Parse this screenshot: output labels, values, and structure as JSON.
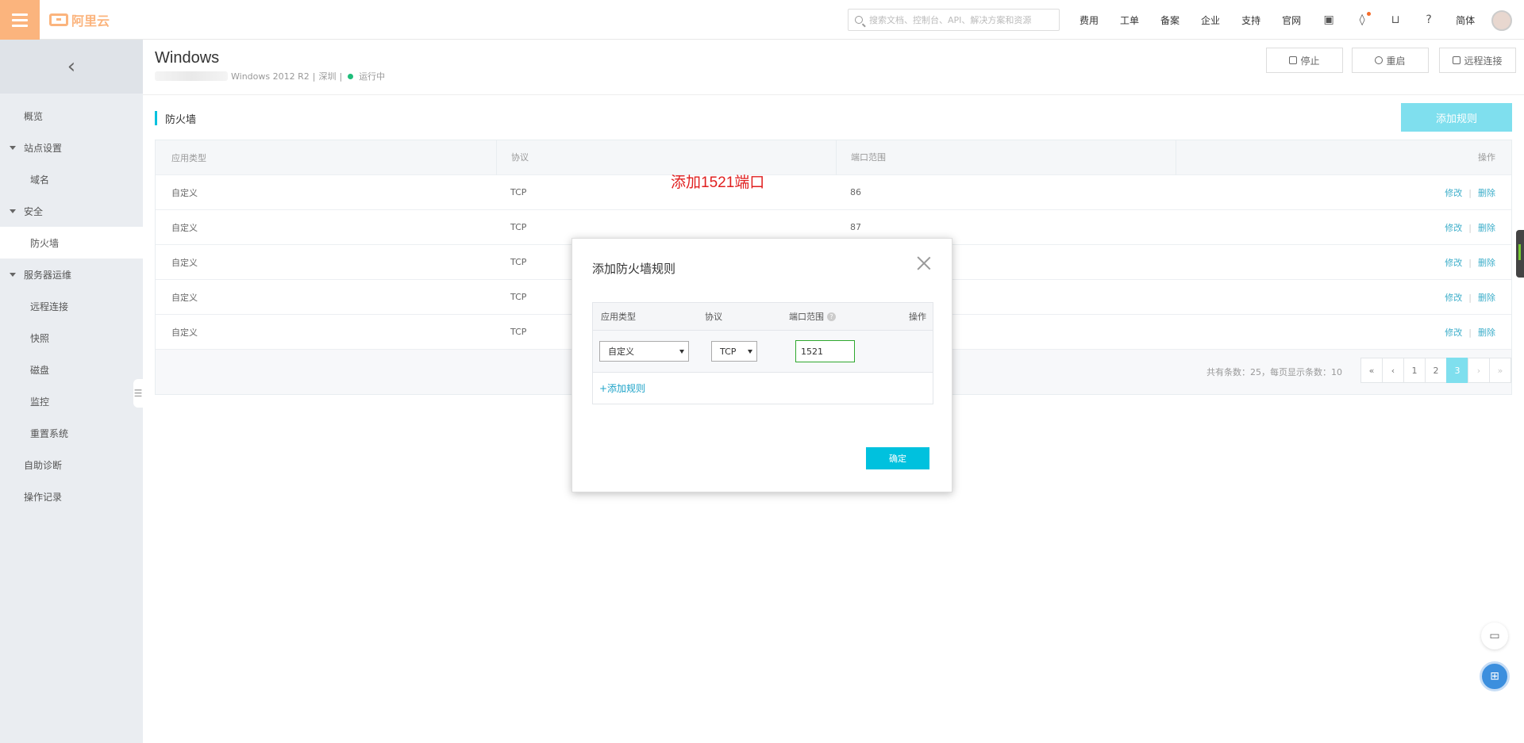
{
  "topbar": {
    "logo_text": "阿里云",
    "search_placeholder": "搜索文档、控制台、API、解决方案和资源",
    "nav": [
      "费用",
      "工单",
      "备案",
      "企业",
      "支持",
      "官网"
    ],
    "lang": "简体"
  },
  "sidebar": {
    "collapse_glyph": "‹",
    "items": [
      {
        "label": "概览",
        "kind": "top"
      },
      {
        "label": "站点设置",
        "kind": "group"
      },
      {
        "label": "域名",
        "kind": "sub"
      },
      {
        "label": "安全",
        "kind": "group"
      },
      {
        "label": "防火墙",
        "kind": "sub",
        "active": true
      },
      {
        "label": "服务器运维",
        "kind": "group"
      },
      {
        "label": "远程连接",
        "kind": "sub"
      },
      {
        "label": "快照",
        "kind": "sub"
      },
      {
        "label": "磁盘",
        "kind": "sub"
      },
      {
        "label": "监控",
        "kind": "sub"
      },
      {
        "label": "重置系统",
        "kind": "sub"
      },
      {
        "label": "自助诊断",
        "kind": "top"
      },
      {
        "label": "操作记录",
        "kind": "top"
      }
    ]
  },
  "header": {
    "title": "Windows",
    "os": "Windows 2012 R2",
    "region": "深圳",
    "status": "运行中",
    "sep": "|",
    "buttons": {
      "stop": "停止",
      "restart": "重启",
      "remote": "远程连接"
    }
  },
  "firewall": {
    "section_title": "防火墙",
    "add_rule_label": "添加规则",
    "columns": [
      "应用类型",
      "协议",
      "端口范围",
      "操作"
    ],
    "rows": [
      {
        "app": "自定义",
        "protocol": "TCP",
        "port": "86"
      },
      {
        "app": "自定义",
        "protocol": "TCP",
        "port": "87"
      },
      {
        "app": "自定义",
        "protocol": "TCP",
        "port": ""
      },
      {
        "app": "自定义",
        "protocol": "TCP",
        "port": ""
      },
      {
        "app": "自定义",
        "protocol": "TCP",
        "port": ""
      }
    ],
    "actions": {
      "edit": "修改",
      "delete": "删除",
      "sep": "|"
    },
    "pager_info": "共有条数：25，每页显示条数：10",
    "pages": [
      "«",
      "‹",
      "1",
      "2",
      "3",
      "›",
      "»"
    ],
    "current_page": "3"
  },
  "annotation": "添加1521端口",
  "dialog": {
    "title": "添加防火墙规则",
    "columns": [
      "应用类型",
      "协议",
      "端口范围",
      "操作"
    ],
    "help_glyph": "?",
    "app_value": "自定义",
    "protocol_value": "TCP",
    "port_value": "1521",
    "add_rule_link": "+添加规则",
    "ok_label": "确定"
  },
  "colors": {
    "brand": "#fbb47d",
    "accent": "#00c1de",
    "annotation": "#e02020",
    "status_running": "#1fbd7a"
  }
}
